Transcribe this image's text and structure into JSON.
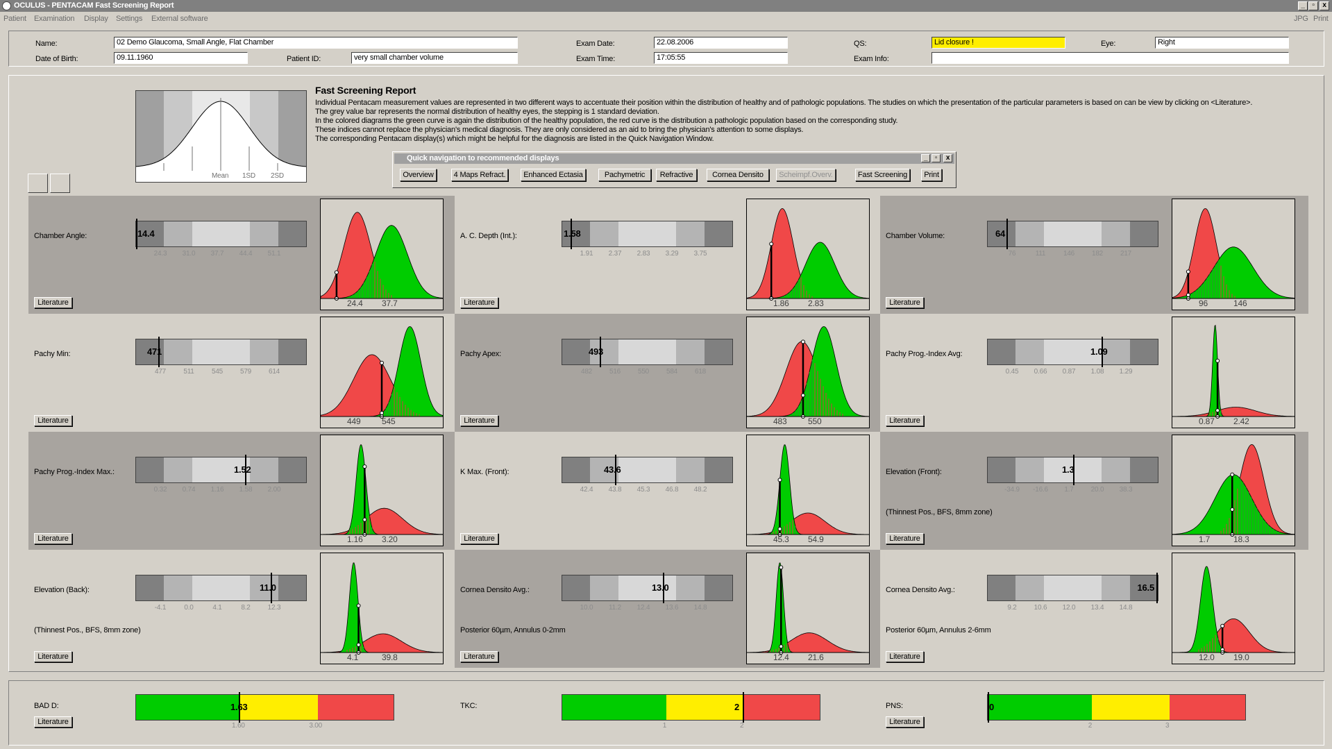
{
  "window": {
    "title": "OCULUS - PENTACAM Fast Screening Report",
    "min": "_",
    "max": "▫",
    "close": "x"
  },
  "menu": [
    "Patient",
    "Examination",
    "Display",
    "Settings",
    "External software"
  ],
  "menu_right": [
    "JPG",
    "Print"
  ],
  "patient": {
    "name_label": "Name:",
    "name": "02 Demo Glaucoma, Small Angle, Flat Chamber",
    "dob_label": "Date of Birth:",
    "dob": "09.11.1960",
    "pid_label": "Patient ID:",
    "pid": "very small chamber volume",
    "exam_date_label": "Exam Date:",
    "exam_date": "22.08.2006",
    "exam_time_label": "Exam Time:",
    "exam_time": "17:05:55",
    "qs_label": "QS:",
    "qs": "Lid closure !",
    "eye_label": "Eye:",
    "eye": "Right",
    "info_label": "Exam Info:",
    "info": ""
  },
  "bell": {
    "mean": "Mean",
    "sd1": "1SD",
    "sd2": "2SD"
  },
  "intro": {
    "title": "Fast Screening Report",
    "lines": [
      "Individual Pentacam measurement values are represented in two different ways to accentuate their position within the distribution of healthy and of pathologic populations. The studies on which the presentation of the particular parameters is based on can be view by clicking on <Literature>.",
      "The grey value bar represents the normal distribution of healthy eyes, the stepping is 1 standard deviation.",
      "In the colored diagrams the green curve is again the distribution of the healthy population, the red curve is the distribution a pathologic population based on the corresponding study.",
      "These indices cannot replace the physician's medical diagnosis. They are only considered as an aid to bring the physician's attention to some displays.",
      "The corresponding Pentacam display(s) which might be helpful for the diagnosis are listed in the Quick Navigation Window."
    ]
  },
  "quicknav": {
    "title": "Quick navigation to recommended displays",
    "buttons": [
      "Overview",
      "4 Maps Refract.",
      "Enhanced Ectasia",
      "Pachymetric",
      "Refractive",
      "Cornea Densito",
      "Scheimpf.Overv.",
      "Fast Screening",
      "Print"
    ],
    "disabled": [
      false,
      false,
      false,
      false,
      false,
      false,
      true,
      false,
      false
    ]
  },
  "literature": "Literature",
  "parameters": [
    {
      "name": "Chamber Angle:",
      "sub": "",
      "value": "14.4",
      "pos": 0.0,
      "ticks": [
        "24.3",
        "31.0",
        "37.7",
        "44.4",
        "51.1"
      ],
      "green_label": "37.7",
      "red_label": "24.4",
      "green": {
        "mu": 0.58,
        "sd": 0.13,
        "h": 0.78
      },
      "red": {
        "mu": 0.3,
        "sd": 0.11,
        "h": 0.92
      },
      "line_x": 0.13
    },
    {
      "name": "A. C. Depth (Int.):",
      "sub": "",
      "value": "1.58",
      "pos": 0.05,
      "ticks": [
        "1.91",
        "2.37",
        "2.83",
        "3.29",
        "3.75"
      ],
      "green_label": "2.83",
      "red_label": "1.86",
      "green": {
        "mu": 0.6,
        "sd": 0.12,
        "h": 0.6
      },
      "red": {
        "mu": 0.29,
        "sd": 0.09,
        "h": 0.96
      },
      "line_x": 0.2
    },
    {
      "name": "Chamber Volume:",
      "sub": "",
      "value": "64",
      "pos": 0.11,
      "ticks": [
        "76",
        "111",
        "146",
        "182",
        "217"
      ],
      "green_label": "146",
      "red_label": "96",
      "green": {
        "mu": 0.5,
        "sd": 0.16,
        "h": 0.55
      },
      "red": {
        "mu": 0.27,
        "sd": 0.09,
        "h": 0.96
      },
      "line_x": 0.13
    },
    {
      "name": "Pachy Min:",
      "sub": "",
      "value": "471",
      "pos": 0.13,
      "ticks": [
        "477",
        "511",
        "545",
        "579",
        "614"
      ],
      "green_label": "545",
      "red_label": "449",
      "green": {
        "mu": 0.73,
        "sd": 0.09,
        "h": 0.96
      },
      "red": {
        "mu": 0.42,
        "sd": 0.15,
        "h": 0.66
      },
      "line_x": 0.5
    },
    {
      "name": "Pachy Apex:",
      "sub": "",
      "value": "493",
      "pos": 0.22,
      "ticks": [
        "482",
        "516",
        "550",
        "584",
        "618"
      ],
      "green_label": "550",
      "red_label": "483",
      "green": {
        "mu": 0.63,
        "sd": 0.1,
        "h": 0.96
      },
      "red": {
        "mu": 0.45,
        "sd": 0.13,
        "h": 0.8
      },
      "line_x": 0.46
    },
    {
      "name": "Pachy Prog.-Index Avg:",
      "sub": "",
      "value": "1.09",
      "pos": 0.67,
      "ticks": [
        "0.45",
        "0.66",
        "0.87",
        "1.08",
        "1.29"
      ],
      "green_label": "0.87",
      "red_label": "2.42",
      "green": {
        "mu": 0.35,
        "sd": 0.02,
        "h": 0.98
      },
      "red": {
        "mu": 0.52,
        "sd": 0.16,
        "h": 0.1
      },
      "line_x": 0.37
    },
    {
      "name": "Pachy Prog.-Index Max.:",
      "sub": "",
      "value": "1.52",
      "pos": 0.64,
      "ticks": [
        "0.32",
        "0.74",
        "1.16",
        "1.58",
        "2.00"
      ],
      "green_label": "1.16",
      "red_label": "3.20",
      "green": {
        "mu": 0.33,
        "sd": 0.04,
        "h": 0.96
      },
      "red": {
        "mu": 0.52,
        "sd": 0.15,
        "h": 0.28
      },
      "line_x": 0.36
    },
    {
      "name": "K Max. (Front):",
      "sub": "",
      "value": "43.6",
      "pos": 0.31,
      "ticks": [
        "42.4",
        "43.8",
        "45.3",
        "46.8",
        "48.2"
      ],
      "green_label": "45.3",
      "red_label": "54.9",
      "green": {
        "mu": 0.31,
        "sd": 0.04,
        "h": 0.96
      },
      "red": {
        "mu": 0.5,
        "sd": 0.14,
        "h": 0.23
      },
      "line_x": 0.27
    },
    {
      "name": "Elevation (Front):",
      "sub": "(Thinnest Pos., BFS, 8mm zone)",
      "value": "1.3",
      "pos": 0.5,
      "ticks": [
        "-34.9",
        "-16.6",
        "1.7",
        "20.0",
        "38.3"
      ],
      "green_label": "1.7",
      "red_label": "18.3",
      "green": {
        "mu": 0.5,
        "sd": 0.15,
        "h": 0.64
      },
      "red": {
        "mu": 0.65,
        "sd": 0.1,
        "h": 0.96
      },
      "line_x": 0.49
    },
    {
      "name": "Elevation (Back):",
      "sub": "(Thinnest Pos., BFS, 8mm zone)",
      "value": "11.0",
      "pos": 0.79,
      "ticks": [
        "-4.1",
        "0.0",
        "4.1",
        "8.2",
        "12.3"
      ],
      "green_label": "4.1",
      "red_label": "39.8",
      "green": {
        "mu": 0.27,
        "sd": 0.035,
        "h": 0.96
      },
      "red": {
        "mu": 0.51,
        "sd": 0.15,
        "h": 0.2
      },
      "line_x": 0.31
    },
    {
      "name": "Cornea Densito Avg.:",
      "sub": "Posterior 60µm, Annulus 0-2mm",
      "value": "13.0",
      "pos": 0.59,
      "ticks": [
        "10.0",
        "11.2",
        "12.4",
        "13.6",
        "14.8"
      ],
      "green_label": "12.4",
      "red_label": "21.6",
      "green": {
        "mu": 0.27,
        "sd": 0.03,
        "h": 0.96
      },
      "red": {
        "mu": 0.51,
        "sd": 0.15,
        "h": 0.21
      },
      "line_x": 0.28
    },
    {
      "name": "Cornea Densito Avg.:",
      "sub": "Posterior 60µm, Annulus 2-6mm",
      "value": "16.5",
      "pos": 0.99,
      "ticks": [
        "9.2",
        "10.6",
        "12.0",
        "13.4",
        "14.8"
      ],
      "green_label": "12.0",
      "red_label": "19.0",
      "green": {
        "mu": 0.28,
        "sd": 0.05,
        "h": 0.92
      },
      "red": {
        "mu": 0.5,
        "sd": 0.13,
        "h": 0.36
      },
      "line_x": 0.41
    }
  ],
  "scores": [
    {
      "name": "BAD D:",
      "value": "1.63",
      "pos": 0.4,
      "ticks": [
        {
          "t": "1.60",
          "p": 0.4
        },
        {
          "t": "3.00",
          "p": 0.7
        }
      ],
      "literature": true
    },
    {
      "name": "TKC:",
      "value": "2",
      "pos": 0.7,
      "ticks": [
        {
          "t": "1",
          "p": 0.4
        },
        {
          "t": "2",
          "p": 0.7
        }
      ],
      "literature": false
    },
    {
      "name": "PNS:",
      "value": "0",
      "pos": 0.0,
      "ticks": [
        {
          "t": "2",
          "p": 0.4
        },
        {
          "t": "3",
          "p": 0.7
        }
      ],
      "literature": true
    }
  ],
  "colors": {
    "green": "#00cc00",
    "red": "#f04848",
    "yellow": "#ffee00",
    "cell_dark": "#a8a49f",
    "cell_light": "#d4d0c8"
  }
}
